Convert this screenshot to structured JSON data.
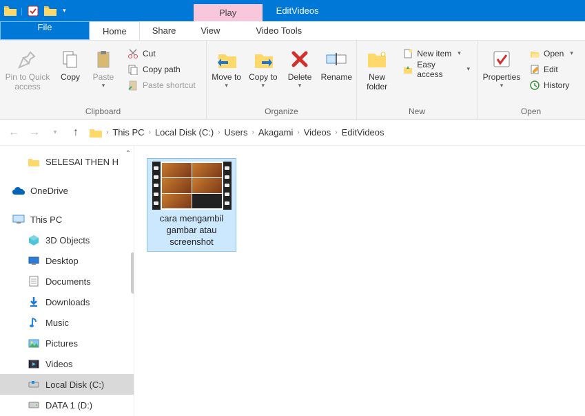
{
  "titlebar": {
    "contextual_tab": "Play",
    "title": "EditVideos"
  },
  "tabs": {
    "file": "File",
    "home": "Home",
    "share": "Share",
    "view": "View",
    "video_tools": "Video Tools"
  },
  "ribbon": {
    "clipboard": {
      "label": "Clipboard",
      "pin": "Pin to Quick access",
      "copy": "Copy",
      "paste": "Paste",
      "cut": "Cut",
      "copy_path": "Copy path",
      "paste_shortcut": "Paste shortcut"
    },
    "organize": {
      "label": "Organize",
      "move_to": "Move to",
      "copy_to": "Copy to",
      "delete": "Delete",
      "rename": "Rename"
    },
    "new": {
      "label": "New",
      "new_folder": "New folder",
      "new_item": "New item",
      "easy_access": "Easy access"
    },
    "open": {
      "label": "Open",
      "properties": "Properties",
      "open": "Open",
      "edit": "Edit",
      "history": "History"
    }
  },
  "breadcrumb": [
    "This PC",
    "Local Disk (C:)",
    "Users",
    "Akagami",
    "Videos",
    "EditVideos"
  ],
  "sidebar": {
    "item0": "SELESAI THEN H",
    "onedrive": "OneDrive",
    "thispc": "This PC",
    "objects3d": "3D Objects",
    "desktop": "Desktop",
    "documents": "Documents",
    "downloads": "Downloads",
    "music": "Music",
    "pictures": "Pictures",
    "videos": "Videos",
    "localdisk": "Local Disk (C:)",
    "data1": "DATA 1 (D:)"
  },
  "files": {
    "item0": "cara mengambil gambar atau screenshot"
  }
}
